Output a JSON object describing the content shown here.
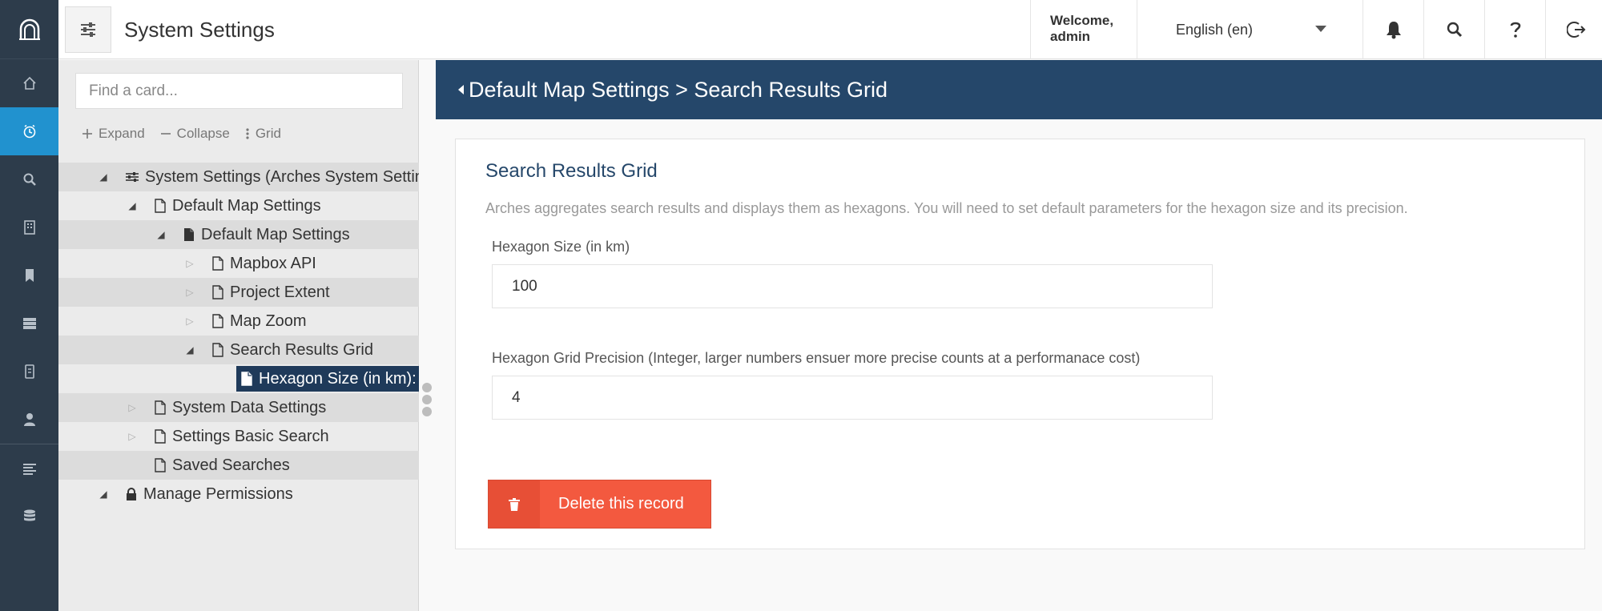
{
  "header": {
    "title": "System Settings",
    "welcome_line1": "Welcome,",
    "welcome_line2": "admin",
    "language": "English (en)"
  },
  "rail": {
    "items": [
      "home-icon",
      "clock-icon",
      "search-icon",
      "building-icon",
      "bookmark-icon",
      "server-icon",
      "graph-icon",
      "user-icon",
      "list-icon",
      "database-icon"
    ],
    "active_index": 1,
    "colors": {
      "rail_bg": "#2d3c4b",
      "active": "#2192cf"
    }
  },
  "tree": {
    "search_placeholder": "Find a card...",
    "tools": {
      "expand": "Expand",
      "collapse": "Collapse",
      "grid": "Grid"
    },
    "rows": [
      {
        "label": "System Settings (Arches System Settings)",
        "icon": "sliders-icon"
      },
      {
        "label": "Default Map Settings",
        "icon": "file-outline-icon"
      },
      {
        "label": "Default Map Settings",
        "icon": "file-solid-icon"
      },
      {
        "label": "Mapbox API",
        "icon": "file-outline-icon"
      },
      {
        "label": "Project Extent",
        "icon": "file-outline-icon"
      },
      {
        "label": "Map Zoom",
        "icon": "file-outline-icon"
      },
      {
        "label": "Search Results Grid",
        "icon": "file-outline-icon"
      },
      {
        "label": "Hexagon Size (in km):",
        "icon": "file-outline-icon",
        "selected": true
      },
      {
        "label": "System Data Settings",
        "icon": "file-outline-icon"
      },
      {
        "label": "Settings Basic Search",
        "icon": "file-outline-icon"
      },
      {
        "label": "Saved Searches",
        "icon": "file-outline-icon"
      },
      {
        "label": "Manage Permissions",
        "icon": "lock-icon"
      }
    ]
  },
  "main": {
    "breadcrumb": "Default Map Settings > Search Results Grid",
    "card_title": "Search Results Grid",
    "card_description": "Arches aggregates search results and displays them as hexagons. You will need to set default parameters for the hexagon size and its precision.",
    "field1_label": "Hexagon Size (in km)",
    "field1_value": "100",
    "field2_label": "Hexagon Grid Precision (Integer, larger numbers ensuer more precise counts at a performanace cost)",
    "field2_value": "4",
    "delete_label": "Delete this record",
    "colors": {
      "banner": "#25476a",
      "delete": "#f3593f",
      "selected_node": "#1f3a5a"
    }
  }
}
